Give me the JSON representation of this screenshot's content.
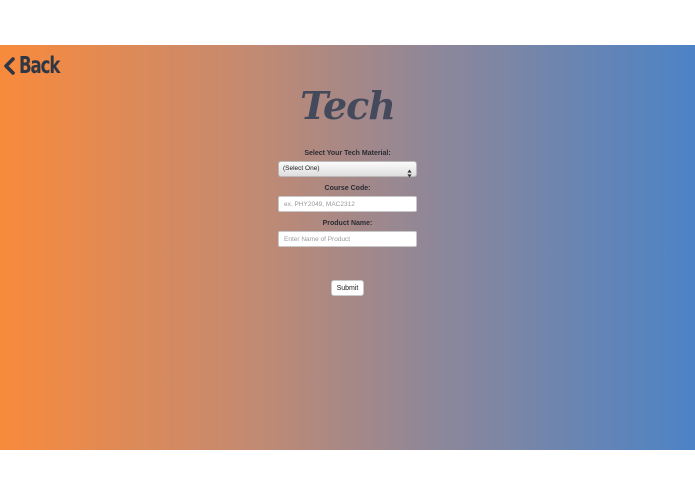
{
  "nav": {
    "back_label": "Back",
    "back_icon": "chevron-left-icon"
  },
  "page": {
    "title": "Tech"
  },
  "form": {
    "material": {
      "label": "Select Your Tech Material:",
      "selected": "(Select One)",
      "icon": "select-arrows-icon"
    },
    "course_code": {
      "label": "Course Code:",
      "value": "",
      "placeholder": "ex. PHY2049, MAC2312"
    },
    "product_name": {
      "label": "Product Name:",
      "value": "",
      "placeholder": "Enter Name of Product"
    },
    "submit_label": "Submit"
  },
  "colors": {
    "gradient_start": "#f98a3c",
    "gradient_end": "#4c83c6",
    "title": "#444a5b",
    "back": "#2f3644"
  }
}
